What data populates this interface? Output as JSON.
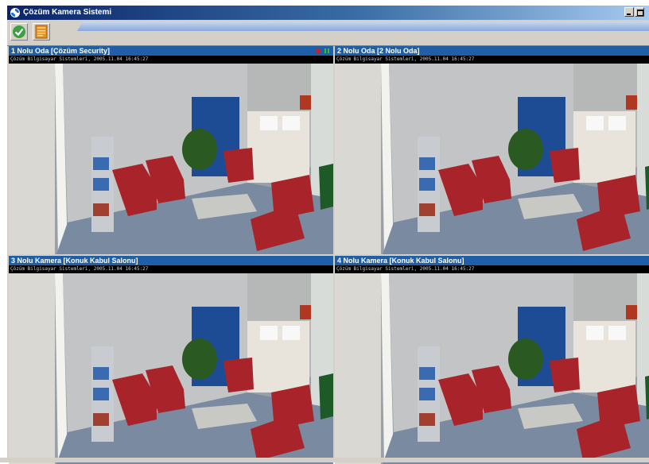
{
  "window": {
    "title": "Çözüm Kamera Sistemi",
    "titlebar_colors": [
      "#0a246a",
      "#a6caf0"
    ]
  },
  "toolbar": {
    "buttons": [
      {
        "icon": "checkmark-icon",
        "color": "#3aa040"
      },
      {
        "icon": "camera-settings-icon",
        "color": "#e89020"
      }
    ]
  },
  "cameras": [
    {
      "title": "1 Nolu Oda [Çözüm Security]",
      "osd": "Çözüm Bilgisayar Sistemleri, 2005.11.04 16:45:27",
      "recording": true
    },
    {
      "title": "2 Nolu Oda [2 Nolu Oda]",
      "osd": "Çözüm Bilgisayar Sistemleri, 2005.11.04 16:45:27",
      "recording": false
    },
    {
      "title": "3 Nolu Kamera [Konuk Kabul Salonu]",
      "osd": "Çözüm Bilgisayar Sistemleri, 2005.11.04 16:45:27",
      "recording": false
    },
    {
      "title": "4 Nolu Kamera [Konuk Kabul Salonu]",
      "osd": "Çözüm Bilgisayar Sistemleri, 2005.11.04 16:45:27",
      "recording": false
    }
  ],
  "colors": {
    "panel_header": "#1f5fa8",
    "record_indicator": "#e01818",
    "pause_indicator": "#30c030"
  }
}
